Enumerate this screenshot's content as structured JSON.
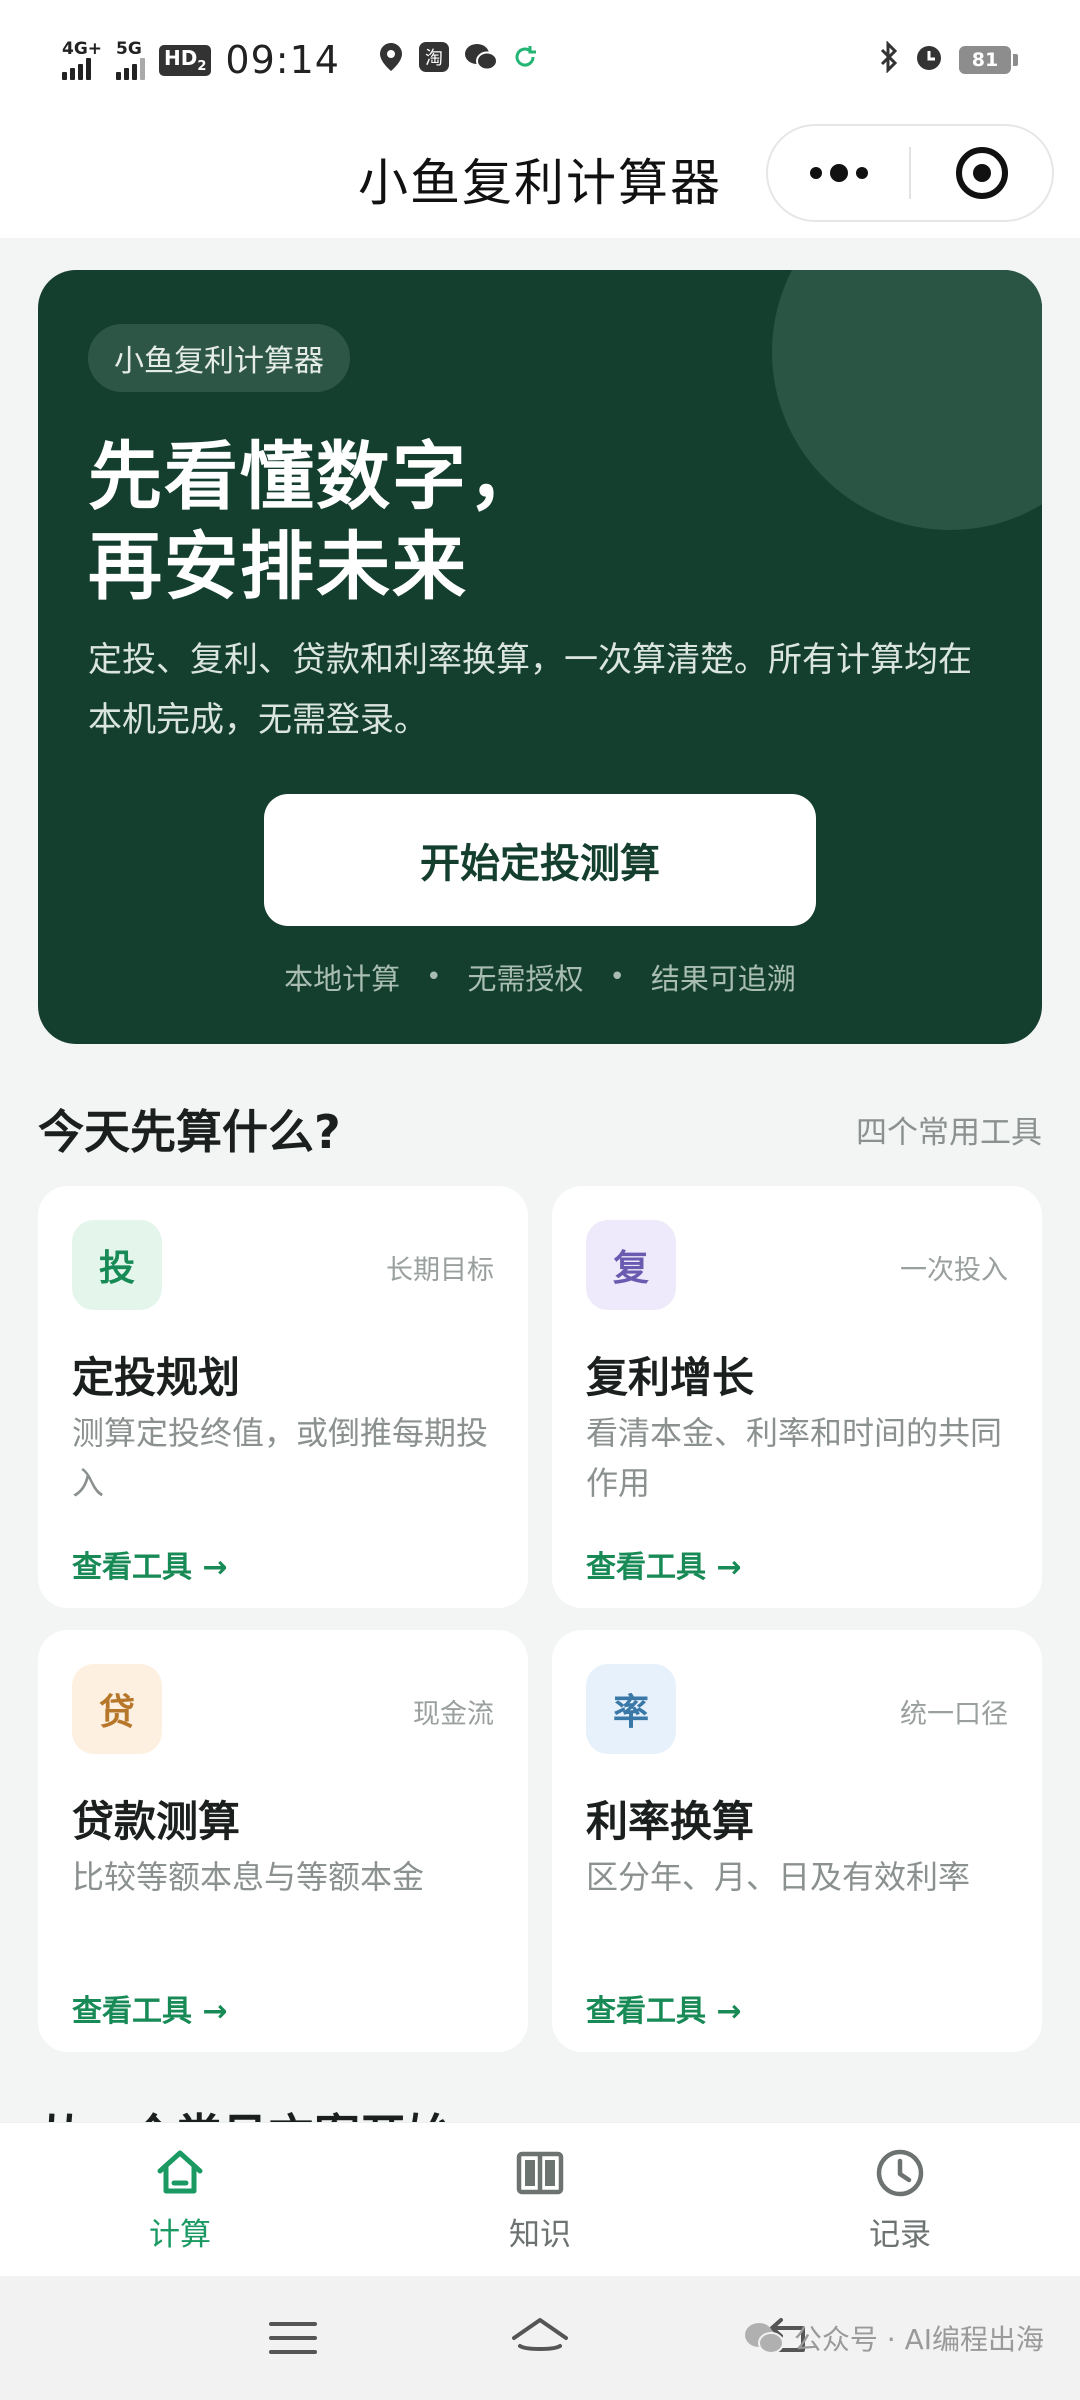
{
  "status_bar": {
    "network1": "4G+",
    "network2": "5G",
    "hd": "HD",
    "hd_sub": "2",
    "time": "09:14",
    "app_icons": [
      "location-icon",
      "taobao-icon",
      "wechat-icon",
      "sync-icon"
    ],
    "tb_glyph": "淘",
    "battery": "81"
  },
  "header": {
    "title": "小鱼复利计算器"
  },
  "hero": {
    "tag": "小鱼复利计算器",
    "title_line1": "先看懂数字，",
    "title_line2": "再安排未来",
    "desc": "定投、复利、贷款和利率换算，一次算清楚。所有计算均在本机完成，无需登录。",
    "button": "开始定投测算",
    "features": [
      "本地计算",
      "无需授权",
      "结果可追溯"
    ],
    "separator": "•"
  },
  "section": {
    "title": "今天先算什么?",
    "aside": "四个常用工具"
  },
  "tools": [
    {
      "badge": "投",
      "tag": "长期目标",
      "title": "定投规划",
      "desc": "测算定投终值，或倒推每期投入",
      "link": "查看工具 →",
      "badge_color": "#178a56",
      "badge_bg": "#e4f5ec"
    },
    {
      "badge": "复",
      "tag": "一次投入",
      "title": "复利增长",
      "desc": "看清本金、利率和时间的共同作用",
      "link": "查看工具 →",
      "badge_color": "#6b5bb0",
      "badge_bg": "#eeeafb"
    },
    {
      "badge": "贷",
      "tag": "现金流",
      "title": "贷款测算",
      "desc": "比较等额本息与等额本金",
      "link": "查看工具 →",
      "badge_color": "#b7772b",
      "badge_bg": "#fdf0e1"
    },
    {
      "badge": "率",
      "tag": "统一口径",
      "title": "利率换算",
      "desc": "区分年、月、日及有效利率",
      "link": "查看工具 →",
      "badge_color": "#3a78a8",
      "badge_bg": "#e6f1fb"
    }
  ],
  "peek_title": "从一个常见方案开始",
  "tabbar": {
    "items": [
      {
        "label": "计算",
        "icon": "home-icon",
        "active": true
      },
      {
        "label": "知识",
        "icon": "book-icon",
        "active": false
      },
      {
        "label": "记录",
        "icon": "clock-icon",
        "active": false
      }
    ],
    "active_color": "#1a9a62"
  },
  "watermark": "公众号 · AI编程出海",
  "colors": {
    "hero_bg": "#143f2e",
    "accent": "#178a56",
    "page_bg": "#f3f5f4"
  }
}
